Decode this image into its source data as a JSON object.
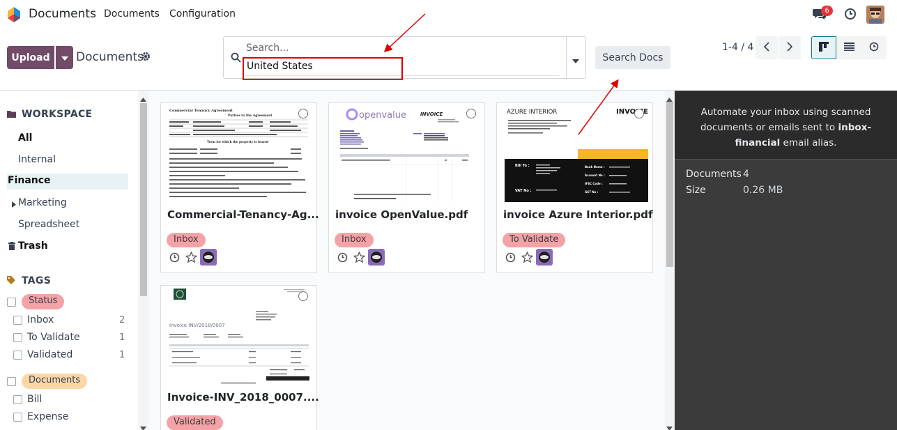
{
  "navbar": {
    "app_name": "Documents",
    "menu": [
      "Documents",
      "Configuration"
    ],
    "chat_badge": "6"
  },
  "control_panel": {
    "upload_label": "Upload",
    "breadcrumb": "Documents",
    "search": {
      "placeholder": "Search...",
      "value": "United States"
    },
    "search_docs_label": "Search Docs",
    "pager": "1-4 / 4"
  },
  "sidebar": {
    "workspace_heading": "WORKSPACE",
    "workspaces": [
      {
        "label": "All"
      },
      {
        "label": "Internal"
      },
      {
        "label": "Finance"
      },
      {
        "label": "Marketing"
      },
      {
        "label": "Spreadsheet"
      },
      {
        "label": "Trash"
      }
    ],
    "tags_heading": "TAGS",
    "tag_groups": [
      {
        "name": "Status",
        "color": "#f3a2a6",
        "items": [
          {
            "label": "Inbox",
            "count": "2"
          },
          {
            "label": "To Validate",
            "count": "1"
          },
          {
            "label": "Validated",
            "count": "1"
          }
        ]
      },
      {
        "name": "Documents",
        "color": "#fbd6a6",
        "items": [
          {
            "label": "Bill",
            "count": ""
          },
          {
            "label": "Expense",
            "count": ""
          }
        ]
      }
    ]
  },
  "cards": [
    {
      "title": "Commercial-Tenancy-Ag...",
      "tag": "Inbox"
    },
    {
      "title": "invoice OpenValue.pdf",
      "tag": "Inbox"
    },
    {
      "title": "invoice Azure Interior.pdf",
      "tag": "To Validate"
    },
    {
      "title": "Invoice-INV_2018_0007....",
      "tag": "Validated"
    }
  ],
  "thumbnails": {
    "tenancy": {
      "heading": "Commercial Tenancy Agreement",
      "subheading": "Parties to the Agreement",
      "section": "Term for which the property is leased"
    },
    "openvalue": {
      "brand": "openvalue",
      "doc_title": "INVOICE"
    },
    "azure": {
      "company": "AZURE INTERIOR",
      "doc_title": "INVOICE",
      "bill_to": "Bill To :",
      "vat_no": "VAT No :",
      "bank_name": "Bank Name :",
      "account_no": "Account No :",
      "ifsc_code": "IFSC Code :",
      "gst_no": "GST No :"
    },
    "inv2018": {
      "title": "Invoice INV/2018/0007"
    }
  },
  "right_panel": {
    "message_before": "Automate your inbox using scanned documents or emails sent to ",
    "alias": "inbox-financial",
    "message_after": " email alias.",
    "stats": [
      {
        "label": "Documents",
        "value": "4"
      },
      {
        "label": "Size",
        "value": "0.26 MB"
      }
    ]
  },
  "colors": {
    "brand": "#714B67",
    "accent": "#017e84",
    "annotation": "#e00000"
  }
}
